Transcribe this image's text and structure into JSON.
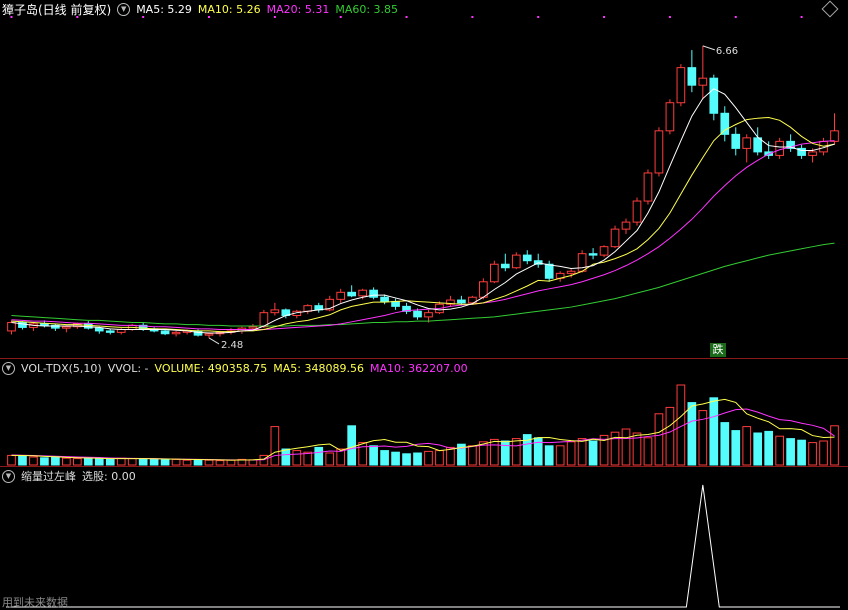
{
  "main": {
    "title": "獐子岛(日线 前复权)",
    "ma": [
      {
        "label": "MA5: 5.29",
        "color": "#ffffff"
      },
      {
        "label": "MA10: 5.26",
        "color": "#ffff4d"
      },
      {
        "label": "MA20: 5.31",
        "color": "#ff33ff"
      },
      {
        "label": "MA60: 3.85",
        "color": "#33cc33"
      }
    ],
    "high_label": "6.66",
    "low_label": "2.48",
    "signal_label": "跌"
  },
  "volume": {
    "indicator": "VOL-TDX(5,10)",
    "vvol": "VVOL: -",
    "volume": "VOLUME: 490358.75",
    "ma5": "MA5: 348089.56",
    "ma10": "MA10: 362207.00",
    "volume_color": "#ffff4d",
    "ma5_color": "#ffff4d",
    "ma10_color": "#ff33ff"
  },
  "sub": {
    "indicator": "缩量过左峰",
    "select": "选股: 0.00",
    "footer": "用到未来数据"
  },
  "icons": {
    "settings": "circle-down-icon",
    "diamond": "diamond-icon"
  },
  "chart_data": {
    "type": "candlestick",
    "y_range": [
      2.3,
      7.0
    ],
    "candles": [
      [
        2.6,
        2.75,
        2.55,
        2.72
      ],
      [
        2.72,
        2.74,
        2.62,
        2.65
      ],
      [
        2.65,
        2.72,
        2.6,
        2.7
      ],
      [
        2.7,
        2.75,
        2.65,
        2.68
      ],
      [
        2.68,
        2.7,
        2.6,
        2.64
      ],
      [
        2.64,
        2.68,
        2.58,
        2.66
      ],
      [
        2.66,
        2.72,
        2.63,
        2.7
      ],
      [
        2.7,
        2.74,
        2.62,
        2.64
      ],
      [
        2.64,
        2.66,
        2.56,
        2.6
      ],
      [
        2.6,
        2.63,
        2.55,
        2.58
      ],
      [
        2.58,
        2.64,
        2.55,
        2.62
      ],
      [
        2.62,
        2.7,
        2.6,
        2.68
      ],
      [
        2.68,
        2.72,
        2.6,
        2.63
      ],
      [
        2.63,
        2.65,
        2.58,
        2.6
      ],
      [
        2.6,
        2.62,
        2.54,
        2.56
      ],
      [
        2.56,
        2.6,
        2.52,
        2.58
      ],
      [
        2.58,
        2.62,
        2.55,
        2.6
      ],
      [
        2.6,
        2.62,
        2.52,
        2.54
      ],
      [
        2.54,
        2.58,
        2.5,
        2.56
      ],
      [
        2.56,
        2.6,
        2.52,
        2.58
      ],
      [
        2.58,
        2.64,
        2.55,
        2.6
      ],
      [
        2.6,
        2.66,
        2.56,
        2.64
      ],
      [
        2.64,
        2.7,
        2.6,
        2.66
      ],
      [
        2.66,
        2.9,
        2.64,
        2.86
      ],
      [
        2.86,
        3.0,
        2.82,
        2.9
      ],
      [
        2.9,
        2.92,
        2.78,
        2.82
      ],
      [
        2.82,
        2.9,
        2.78,
        2.88
      ],
      [
        2.88,
        2.98,
        2.84,
        2.96
      ],
      [
        2.96,
        3.0,
        2.86,
        2.9
      ],
      [
        2.9,
        3.1,
        2.88,
        3.05
      ],
      [
        3.05,
        3.2,
        3.0,
        3.15
      ],
      [
        3.15,
        3.25,
        3.08,
        3.1
      ],
      [
        3.1,
        3.2,
        3.05,
        3.18
      ],
      [
        3.18,
        3.22,
        3.05,
        3.08
      ],
      [
        3.08,
        3.12,
        2.98,
        3.02
      ],
      [
        3.02,
        3.06,
        2.9,
        2.95
      ],
      [
        2.95,
        3.0,
        2.84,
        2.88
      ],
      [
        2.88,
        2.92,
        2.76,
        2.8
      ],
      [
        2.8,
        2.9,
        2.72,
        2.86
      ],
      [
        2.86,
        3.02,
        2.84,
        2.98
      ],
      [
        2.98,
        3.1,
        2.95,
        3.04
      ],
      [
        3.04,
        3.1,
        2.96,
        3.0
      ],
      [
        3.0,
        3.1,
        2.98,
        3.08
      ],
      [
        3.08,
        3.35,
        3.05,
        3.3
      ],
      [
        3.3,
        3.6,
        3.28,
        3.55
      ],
      [
        3.55,
        3.7,
        3.45,
        3.5
      ],
      [
        3.5,
        3.72,
        3.48,
        3.68
      ],
      [
        3.68,
        3.75,
        3.55,
        3.6
      ],
      [
        3.6,
        3.7,
        3.5,
        3.55
      ],
      [
        3.55,
        3.6,
        3.3,
        3.35
      ],
      [
        3.35,
        3.45,
        3.3,
        3.42
      ],
      [
        3.42,
        3.48,
        3.36,
        3.45
      ],
      [
        3.45,
        3.75,
        3.43,
        3.7
      ],
      [
        3.7,
        3.78,
        3.62,
        3.68
      ],
      [
        3.68,
        3.82,
        3.65,
        3.8
      ],
      [
        3.8,
        4.1,
        3.78,
        4.05
      ],
      [
        4.05,
        4.2,
        3.98,
        4.15
      ],
      [
        4.15,
        4.5,
        4.1,
        4.45
      ],
      [
        4.45,
        4.9,
        4.4,
        4.85
      ],
      [
        4.85,
        5.5,
        4.8,
        5.45
      ],
      [
        5.45,
        5.9,
        5.4,
        5.85
      ],
      [
        5.85,
        6.4,
        5.8,
        6.35
      ],
      [
        6.35,
        6.6,
        6.0,
        6.1
      ],
      [
        6.1,
        6.66,
        5.9,
        6.2
      ],
      [
        6.2,
        6.25,
        5.6,
        5.7
      ],
      [
        5.7,
        5.8,
        5.3,
        5.4
      ],
      [
        5.4,
        5.5,
        5.1,
        5.2
      ],
      [
        5.2,
        5.4,
        5.0,
        5.35
      ],
      [
        5.35,
        5.5,
        5.1,
        5.15
      ],
      [
        5.15,
        5.3,
        5.05,
        5.1
      ],
      [
        5.1,
        5.35,
        5.05,
        5.3
      ],
      [
        5.3,
        5.4,
        5.15,
        5.2
      ],
      [
        5.2,
        5.25,
        5.05,
        5.1
      ],
      [
        5.1,
        5.2,
        5.0,
        5.15
      ],
      [
        5.15,
        5.35,
        5.1,
        5.3
      ],
      [
        5.3,
        5.7,
        5.25,
        5.45
      ]
    ],
    "ma5": [
      2.72,
      2.7,
      2.68,
      2.67,
      2.67,
      2.67,
      2.67,
      2.66,
      2.65,
      2.63,
      2.62,
      2.62,
      2.62,
      2.62,
      2.62,
      2.61,
      2.6,
      2.58,
      2.57,
      2.57,
      2.58,
      2.6,
      2.61,
      2.67,
      2.75,
      2.82,
      2.86,
      2.88,
      2.9,
      2.92,
      2.99,
      3.04,
      3.08,
      3.11,
      3.11,
      3.07,
      3.03,
      2.97,
      2.92,
      2.9,
      2.91,
      2.94,
      2.99,
      3.08,
      3.19,
      3.29,
      3.41,
      3.49,
      3.57,
      3.54,
      3.52,
      3.49,
      3.5,
      3.53,
      3.61,
      3.73,
      3.88,
      4.03,
      4.28,
      4.58,
      4.95,
      5.31,
      5.66,
      5.91,
      6.05,
      5.97,
      5.78,
      5.57,
      5.36,
      5.24,
      5.22,
      5.22,
      5.17,
      5.17,
      5.21,
      5.26
    ],
    "ma10": [
      2.74,
      2.73,
      2.72,
      2.71,
      2.7,
      2.69,
      2.69,
      2.68,
      2.67,
      2.66,
      2.65,
      2.65,
      2.64,
      2.63,
      2.63,
      2.62,
      2.61,
      2.6,
      2.6,
      2.59,
      2.59,
      2.6,
      2.6,
      2.62,
      2.66,
      2.7,
      2.73,
      2.75,
      2.79,
      2.83,
      2.9,
      2.95,
      2.98,
      3.01,
      3.01,
      3.02,
      3.03,
      3.02,
      3.01,
      3.0,
      2.99,
      2.98,
      2.98,
      3.0,
      3.05,
      3.1,
      3.17,
      3.24,
      3.32,
      3.31,
      3.35,
      3.39,
      3.45,
      3.55,
      3.58,
      3.63,
      3.69,
      3.77,
      3.9,
      4.06,
      4.28,
      4.55,
      4.82,
      5.07,
      5.31,
      5.46,
      5.54,
      5.61,
      5.63,
      5.64,
      5.6,
      5.5,
      5.37,
      5.27,
      5.23,
      5.26
    ],
    "ma20": [
      2.76,
      2.75,
      2.74,
      2.74,
      2.73,
      2.72,
      2.71,
      2.71,
      2.7,
      2.69,
      2.68,
      2.68,
      2.67,
      2.66,
      2.66,
      2.65,
      2.64,
      2.63,
      2.63,
      2.62,
      2.62,
      2.62,
      2.62,
      2.62,
      2.63,
      2.64,
      2.65,
      2.66,
      2.67,
      2.68,
      2.7,
      2.73,
      2.76,
      2.79,
      2.82,
      2.86,
      2.89,
      2.9,
      2.91,
      2.92,
      2.95,
      2.97,
      2.98,
      3.0,
      3.02,
      3.05,
      3.09,
      3.13,
      3.17,
      3.2,
      3.23,
      3.26,
      3.3,
      3.35,
      3.4,
      3.46,
      3.53,
      3.61,
      3.7,
      3.8,
      3.92,
      4.05,
      4.19,
      4.35,
      4.52,
      4.67,
      4.81,
      4.93,
      5.03,
      5.12,
      5.18,
      5.22,
      5.26,
      5.28,
      5.3,
      5.31
    ],
    "ma60": [
      2.82,
      2.81,
      2.8,
      2.79,
      2.78,
      2.77,
      2.76,
      2.75,
      2.75,
      2.74,
      2.73,
      2.72,
      2.72,
      2.71,
      2.7,
      2.7,
      2.69,
      2.69,
      2.68,
      2.68,
      2.67,
      2.67,
      2.67,
      2.67,
      2.67,
      2.67,
      2.68,
      2.68,
      2.68,
      2.69,
      2.69,
      2.7,
      2.71,
      2.72,
      2.72,
      2.73,
      2.73,
      2.74,
      2.74,
      2.75,
      2.76,
      2.77,
      2.78,
      2.79,
      2.8,
      2.82,
      2.84,
      2.86,
      2.88,
      2.9,
      2.92,
      2.94,
      2.97,
      3.0,
      3.03,
      3.06,
      3.1,
      3.14,
      3.18,
      3.22,
      3.27,
      3.32,
      3.37,
      3.42,
      3.47,
      3.52,
      3.56,
      3.6,
      3.64,
      3.68,
      3.71,
      3.74,
      3.77,
      3.8,
      3.83,
      3.85
    ],
    "volume_range": [
      0,
      1100000
    ],
    "volumes": [
      120,
      110,
      100,
      90,
      95,
      85,
      80,
      90,
      75,
      70,
      85,
      80,
      75,
      70,
      65,
      70,
      60,
      65,
      60,
      55,
      60,
      70,
      65,
      120,
      480,
      200,
      180,
      160,
      220,
      150,
      200,
      490,
      280,
      240,
      180,
      160,
      140,
      150,
      170,
      180,
      220,
      260,
      240,
      290,
      320,
      300,
      330,
      380,
      340,
      240,
      240,
      290,
      330,
      300,
      370,
      410,
      450,
      400,
      340,
      640,
      720,
      1000,
      780,
      680,
      840,
      530,
      430,
      480,
      400,
      420,
      360,
      330,
      310,
      280,
      300,
      490
    ],
    "vol_ma5": [
      120,
      118,
      115,
      108,
      103,
      96,
      90,
      88,
      85,
      80,
      80,
      80,
      80,
      78,
      75,
      73,
      70,
      68,
      66,
      64,
      61,
      62,
      64,
      74,
      160,
      187,
      209,
      228,
      252,
      262,
      182,
      222,
      266,
      304,
      318,
      284,
      284,
      236,
      230,
      180,
      196,
      219,
      235,
      263,
      295,
      290,
      301,
      310,
      342,
      344,
      319,
      304,
      295,
      322,
      306,
      346,
      340,
      372,
      381,
      408,
      492,
      606,
      738,
      763,
      799,
      820,
      782,
      640,
      585,
      540,
      453,
      454,
      442,
      368,
      344,
      348
    ],
    "vol_ma10": [
      125,
      122,
      118,
      114,
      110,
      105,
      100,
      97,
      93,
      88,
      85,
      83,
      81,
      79,
      77,
      74,
      72,
      70,
      68,
      66,
      64,
      63,
      62,
      66,
      118,
      130,
      136,
      143,
      158,
      175,
      171,
      205,
      228,
      232,
      238,
      224,
      233,
      259,
      270,
      250,
      210,
      211,
      231,
      249,
      252,
      244,
      239,
      263,
      285,
      279,
      288,
      296,
      310,
      328,
      320,
      330,
      332,
      338,
      357,
      371,
      412,
      482,
      548,
      571,
      604,
      650,
      692,
      700,
      661,
      611,
      567,
      555,
      522,
      496,
      458,
      362
    ],
    "select_signal": {
      "index": 63,
      "value": 1
    }
  }
}
